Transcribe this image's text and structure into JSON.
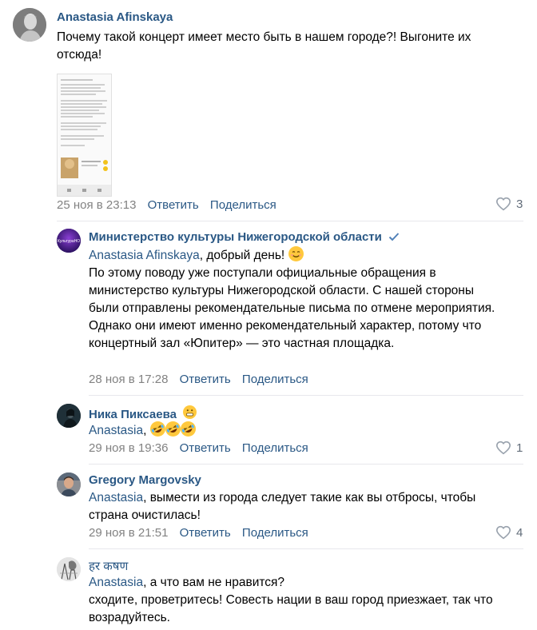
{
  "comments": [
    {
      "author": "Anastasia Afinskaya",
      "text": "Почему такой концерт имеет место быть в нашем городе?! Выгоните их отсюда!",
      "date": "25 ноя в 23:13",
      "reply": "Ответить",
      "share": "Поделиться",
      "likes": "3",
      "avatar_icon": "statue-avatar",
      "attachment": "screenshot-image"
    },
    {
      "author": "Министерство культуры Нижегородской области",
      "verified": true,
      "mention": "Anastasia Afinskaya",
      "text_after_mention": ", добрый день!",
      "text": "По этому поводу уже поступали официальные обращения в министерство культуры Нижегородской области. С нашей стороны были отправлены рекомендательные письма по отмене мероприятия. Однако они имеют именно рекомендательный характер, потому что концертный зал «Юпитер» — это частная площадка.",
      "date": "28 ноя в 17:28",
      "reply": "Ответить",
      "share": "Поделиться",
      "avatar_icon": "ministry-logo",
      "avatar_text": "КультураНО"
    },
    {
      "author": "Ника Пиксаева",
      "mention": "Anastasia",
      "text_after_mention": ",",
      "date": "29 ноя в 19:36",
      "reply": "Ответить",
      "share": "Поделиться",
      "likes": "1",
      "avatar_icon": "dark-portrait-avatar"
    },
    {
      "author": "Gregory Margovsky",
      "mention": "Anastasia",
      "text_after_mention": ", вымести из города следует такие как вы отбросы, чтобы страна очистилась!",
      "date": "29 ноя в 21:51",
      "reply": "Ответить",
      "share": "Поделиться",
      "likes": "4",
      "avatar_icon": "man-portrait-avatar"
    },
    {
      "author": "हर कषण",
      "mention": "Anastasia",
      "text_after_mention": ", а что вам не нравится?",
      "text": "сходите, проветритесь! Совесть нации в ваш город приезжает, так что возрадуйтесь.",
      "avatar_icon": "sketch-avatar"
    }
  ],
  "colors": {
    "link": "#2a5885",
    "meta": "#828282",
    "divider": "#e7e8ec"
  }
}
